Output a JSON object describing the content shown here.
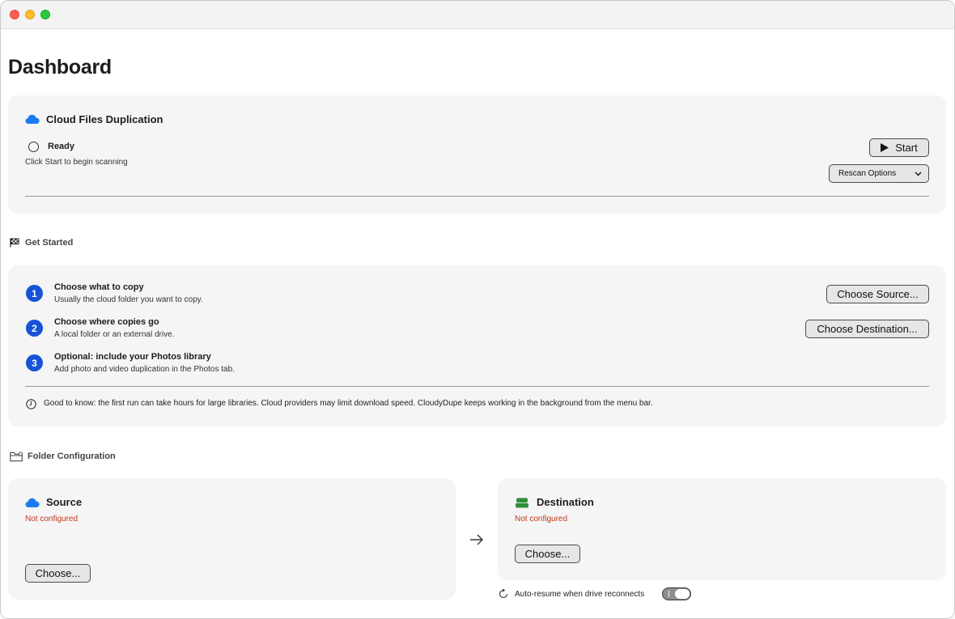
{
  "window": {
    "title": ""
  },
  "page": {
    "title": "Dashboard"
  },
  "duplication": {
    "title": "Cloud Files Duplication",
    "status": "Ready",
    "hint": "Click Start to begin scanning",
    "start_label": "Start",
    "rescan_label": "Rescan Options"
  },
  "get_started": {
    "title": "Get Started",
    "steps": [
      {
        "number": "1",
        "title": "Choose what to copy",
        "subtitle": "Usually the cloud folder you want to copy.",
        "button": "Choose Source..."
      },
      {
        "number": "2",
        "title": "Choose where copies go",
        "subtitle": "A local folder or an external drive.",
        "button": "Choose Destination..."
      },
      {
        "number": "3",
        "title": "Optional: include your Photos library",
        "subtitle": "Add photo and video duplication in the Photos tab."
      }
    ],
    "note": "Good to know: the first run can take hours for large libraries. Cloud providers may limit download speed. CloudyDupe keeps working in the background from the menu bar."
  },
  "folder_config": {
    "title": "Folder Configuration",
    "source": {
      "title": "Source",
      "status": "Not configured",
      "button": "Choose..."
    },
    "destination": {
      "title": "Destination",
      "status": "Not configured",
      "button": "Choose..."
    },
    "auto_resume_label": "Auto-resume when drive reconnects",
    "auto_resume_on": false
  },
  "colors": {
    "accent": "#1753d6",
    "cloud": "#1a7cf0",
    "drive": "#2f8f3a",
    "warning": "#c0391b"
  }
}
